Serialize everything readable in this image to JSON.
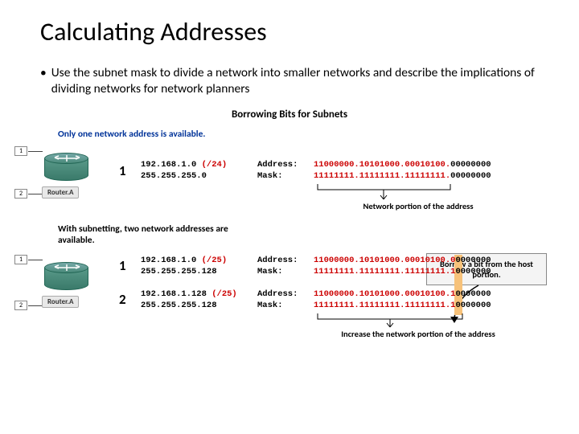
{
  "title": "Calculating Addresses",
  "bullet": "Use the subnet mask to divide a network into smaller networks and describe the implications of dividing networks for network planners",
  "subtitle": "Borrowing Bits for Subnets",
  "section1": {
    "statement": "Only one network address is available.",
    "router_label": "Router.A",
    "port1": "1",
    "port2": "2",
    "row_num": "1",
    "ip": "192.168.1.0 ",
    "cidr": "(/24)",
    "mask": "255.255.255.0",
    "bin_label_addr": "Address:",
    "bin_label_mask": "Mask:",
    "addr_net": "11000000.10101000.00010100.",
    "addr_host": "00000000",
    "mask_net": "11111111.11111111.11111111.",
    "mask_host": "00000000",
    "caption_net": "Network portion of the address"
  },
  "borrow_box": "Borrow a bit from the\nhost portion.",
  "section2": {
    "statement": "With subnetting, two network addresses are\navailable.",
    "router_label": "Router.A",
    "port1": "1",
    "port2": "2",
    "row1": {
      "num": "1",
      "ip": "192.168.1.0 ",
      "cidr": "(/25)",
      "mask": "255.255.255.128",
      "addr_net": "11000000.10101000.00010100.0",
      "addr_host": "0000000",
      "mask_net": "11111111.11111111.11111111.1",
      "mask_host": "0000000"
    },
    "row2": {
      "num": "2",
      "ip": "192.168.1.128 ",
      "cidr": "(/25)",
      "mask": "255.255.255.128",
      "addr_net": "11000000.10101000.00010100.1",
      "addr_host": "0000000",
      "mask_net": "11111111.11111111.11111111.1",
      "mask_host": "0000000"
    },
    "caption_inc": "Increase the network portion of the address"
  },
  "labels": {
    "addr": "Address:",
    "mask": "Mask:"
  }
}
